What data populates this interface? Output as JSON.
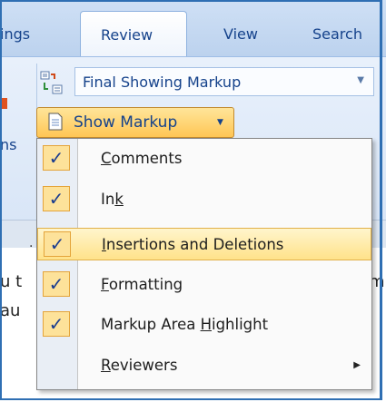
{
  "tabs": {
    "left_partial": "ings",
    "review": "Review",
    "view": "View",
    "search": "Search"
  },
  "ribbon": {
    "display_for_review": "Final Showing Markup",
    "show_markup": "Show Markup",
    "partial_text": "ns"
  },
  "menu": {
    "items": [
      {
        "pre": "",
        "acc": "C",
        "post": "omments",
        "checked": true
      },
      {
        "pre": "In",
        "acc": "k",
        "post": "",
        "checked": true
      },
      {
        "pre": "",
        "acc": "I",
        "post": "nsertions and Deletions",
        "checked": true,
        "highlighted": true
      },
      {
        "pre": "",
        "acc": "F",
        "post": "ormatting",
        "checked": true
      },
      {
        "pre": "Markup Area ",
        "acc": "H",
        "post": "ighlight",
        "checked": true
      },
      {
        "pre": "",
        "acc": "R",
        "post": "eviewers",
        "checked": false,
        "submenu": true
      }
    ]
  },
  "document": {
    "dot": "·",
    "line1": "u t",
    "line2": "au",
    "trailing": "m"
  },
  "glyphs": {
    "check": "✓",
    "dropdown_arrow": "▼",
    "submenu_arrow": "▶"
  }
}
